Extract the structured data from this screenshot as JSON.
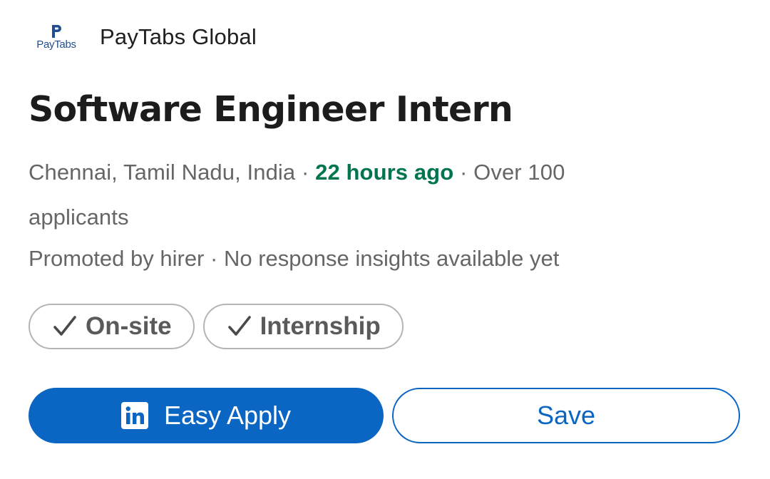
{
  "company": {
    "logo_text": "PayTabs",
    "name": "PayTabs Global"
  },
  "job": {
    "title": "Software Engineer Intern",
    "location": "Chennai, Tamil Nadu, India",
    "separator": " · ",
    "posted": "22 hours ago",
    "applicants": "Over 100 applicants",
    "promoted": "Promoted by hirer",
    "insights": "No response insights available yet"
  },
  "chips": [
    {
      "label": "On-site",
      "icon": "check-icon"
    },
    {
      "label": "Internship",
      "icon": "check-icon"
    }
  ],
  "actions": {
    "easy_apply": "Easy Apply",
    "easy_apply_icon": "linkedin-icon",
    "save": "Save"
  },
  "colors": {
    "brand_blue": "#0a66c2",
    "posted_green": "#01754f",
    "logo_blue": "#1f4e91"
  }
}
